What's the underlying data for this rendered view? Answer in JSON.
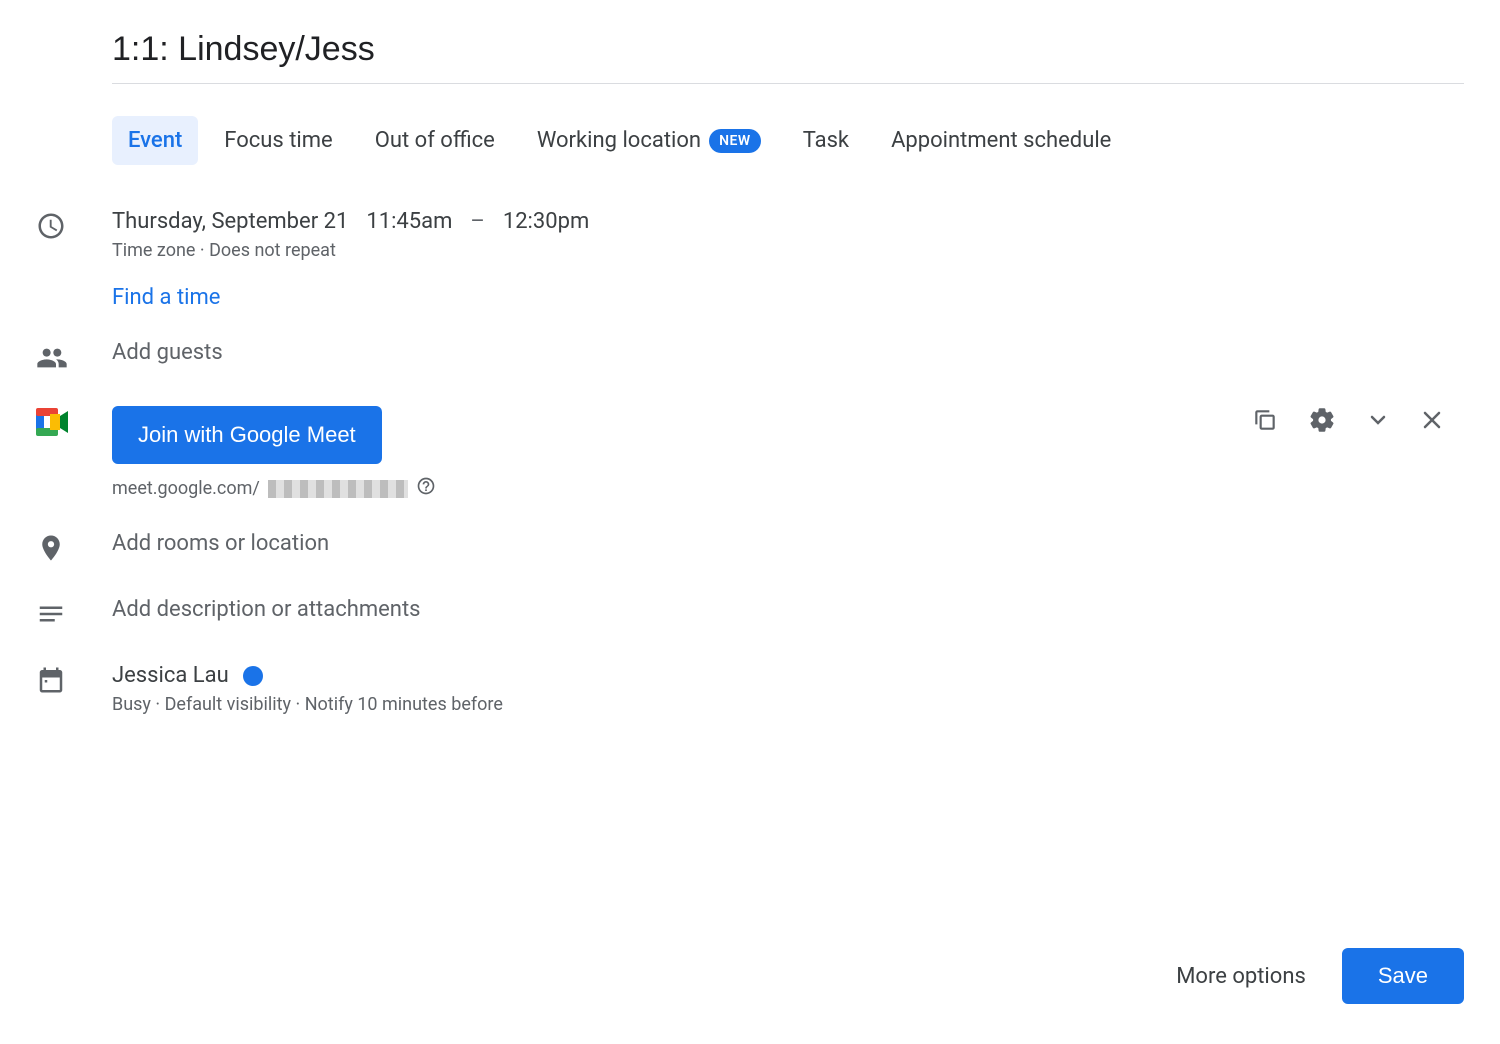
{
  "title": "1:1: Lindsey/Jess",
  "tabs": [
    {
      "label": "Event",
      "active": true
    },
    {
      "label": "Focus time"
    },
    {
      "label": "Out of office"
    },
    {
      "label": "Working location",
      "badge": "NEW"
    },
    {
      "label": "Task"
    },
    {
      "label": "Appointment schedule"
    }
  ],
  "datetime": {
    "date": "Thursday, September 21",
    "start": "11:45am",
    "dash": "–",
    "end": "12:30pm",
    "timezone_label": "Time zone",
    "repeat_label": "Does not repeat"
  },
  "find_time": "Find a time",
  "guests_placeholder": "Add guests",
  "meet": {
    "button": "Join with Google Meet",
    "link_prefix": "meet.google.com/"
  },
  "location_placeholder": "Add rooms or location",
  "description_placeholder": "Add description or attachments",
  "organizer": {
    "name": "Jessica Lau",
    "busy": "Busy",
    "visibility": "Default visibility",
    "notify": "Notify 10 minutes before"
  },
  "footer": {
    "more_options": "More options",
    "save": "Save"
  },
  "sep": " · "
}
